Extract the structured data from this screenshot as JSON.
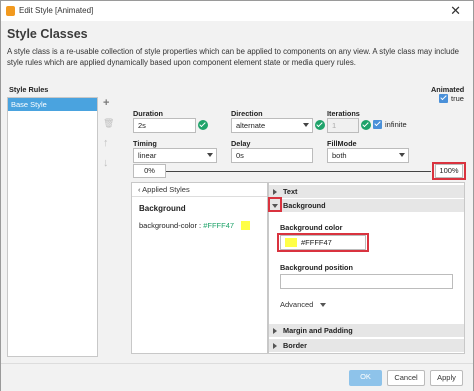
{
  "window": {
    "title": "Edit Style [Animated]",
    "close_glyph": "✕"
  },
  "header": {
    "heading": "Style Classes",
    "description": "A style class is a re-usable collection of style properties which can be applied to components on any view. A style class may include style rules which are applied dynamically based upon component element state or media query rules."
  },
  "style_rules": {
    "label": "Style Rules",
    "items": [
      "Base Style"
    ],
    "add_glyph": "+",
    "delete_glyph": "🗑",
    "up_glyph": "↑",
    "down_glyph": "↓"
  },
  "animated": {
    "label": "Animated",
    "value": "true"
  },
  "animation": {
    "duration": {
      "label": "Duration",
      "value": "2s"
    },
    "direction": {
      "label": "Direction",
      "value": "alternate"
    },
    "iterations": {
      "label": "Iterations",
      "value": "1",
      "infinite_label": "infinite"
    },
    "timing": {
      "label": "Timing",
      "value": "linear"
    },
    "delay": {
      "label": "Delay",
      "value": "0s"
    },
    "fillmode": {
      "label": "FillMode",
      "value": "both"
    }
  },
  "timeline": {
    "start": "0%",
    "end": "100%"
  },
  "applied_styles": {
    "back_label": "‹  Applied Styles",
    "section": "Background",
    "property": "background-color :",
    "value": "#FFFF47"
  },
  "editor": {
    "text_section": "Text",
    "background_section": "Background",
    "bg_color_label": "Background color",
    "bg_color_value": "#FFFF47",
    "bg_position_label": "Background position",
    "bg_position_value": "",
    "advanced_label": "Advanced",
    "margin_section": "Margin and Padding",
    "border_section": "Border"
  },
  "footer": {
    "ok": "OK",
    "cancel": "Cancel",
    "apply": "Apply"
  },
  "colors": {
    "accent": "#4aa3df",
    "swatch": "#FFFF47",
    "highlight": "#d9333f",
    "ok_green": "#1fa36a"
  }
}
